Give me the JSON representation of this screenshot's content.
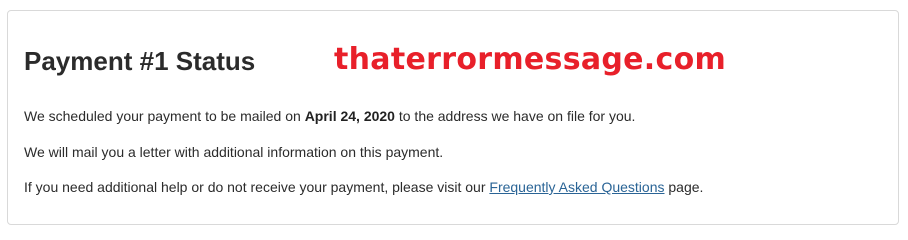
{
  "card": {
    "title": "Payment #1 Status",
    "watermark": "thaterrormessage.com",
    "paragraph_1": {
      "before": "We scheduled your payment to be mailed on ",
      "date": "April 24, 2020",
      "after": " to the address we have on file for you."
    },
    "paragraph_2": "We will mail you a letter with additional information on this payment.",
    "paragraph_3": {
      "before": "If you need additional help or do not receive your payment, please visit our ",
      "link_text": "Frequently Asked Questions",
      "after": " page."
    }
  },
  "colors": {
    "title": "#2b2b2b",
    "watermark": "#e8202a",
    "link": "#2a6496",
    "border": "#d9d9d9"
  }
}
